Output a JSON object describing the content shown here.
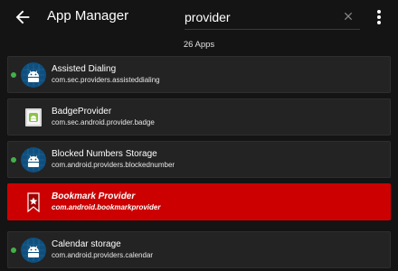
{
  "toolbar": {
    "back_icon": "arrow-back-icon",
    "title": "App Manager",
    "search_value": "provider",
    "clear_icon": "close-icon",
    "more_icon": "more-vert-icon"
  },
  "app_count": "26 Apps",
  "apps": [
    {
      "name": "Assisted Dialing",
      "package": "com.sec.providers.assisteddialing",
      "icon": "android-robot-icon",
      "running": true,
      "highlighted": false
    },
    {
      "name": "BadgeProvider",
      "package": "com.sec.android.provider.badge",
      "icon": "badge-provider-icon",
      "running": false,
      "highlighted": false
    },
    {
      "name": "Blocked Numbers Storage",
      "package": "com.android.providers.blockednumber",
      "icon": "android-robot-icon",
      "running": true,
      "highlighted": false
    },
    {
      "name": "Bookmark Provider",
      "package": "com.android.bookmarkprovider",
      "icon": "bookmark-star-icon",
      "running": false,
      "highlighted": true
    },
    {
      "name": "Calendar storage",
      "package": "com.android.providers.calendar",
      "icon": "android-robot-icon",
      "running": true,
      "highlighted": false
    }
  ],
  "colors": {
    "background": "#141414",
    "card": "#232323",
    "highlight": "#cc0000",
    "running_dot": "#43b049",
    "android_icon_bg": "#0e4f7e",
    "android_icon_fg": "#ffffff"
  }
}
